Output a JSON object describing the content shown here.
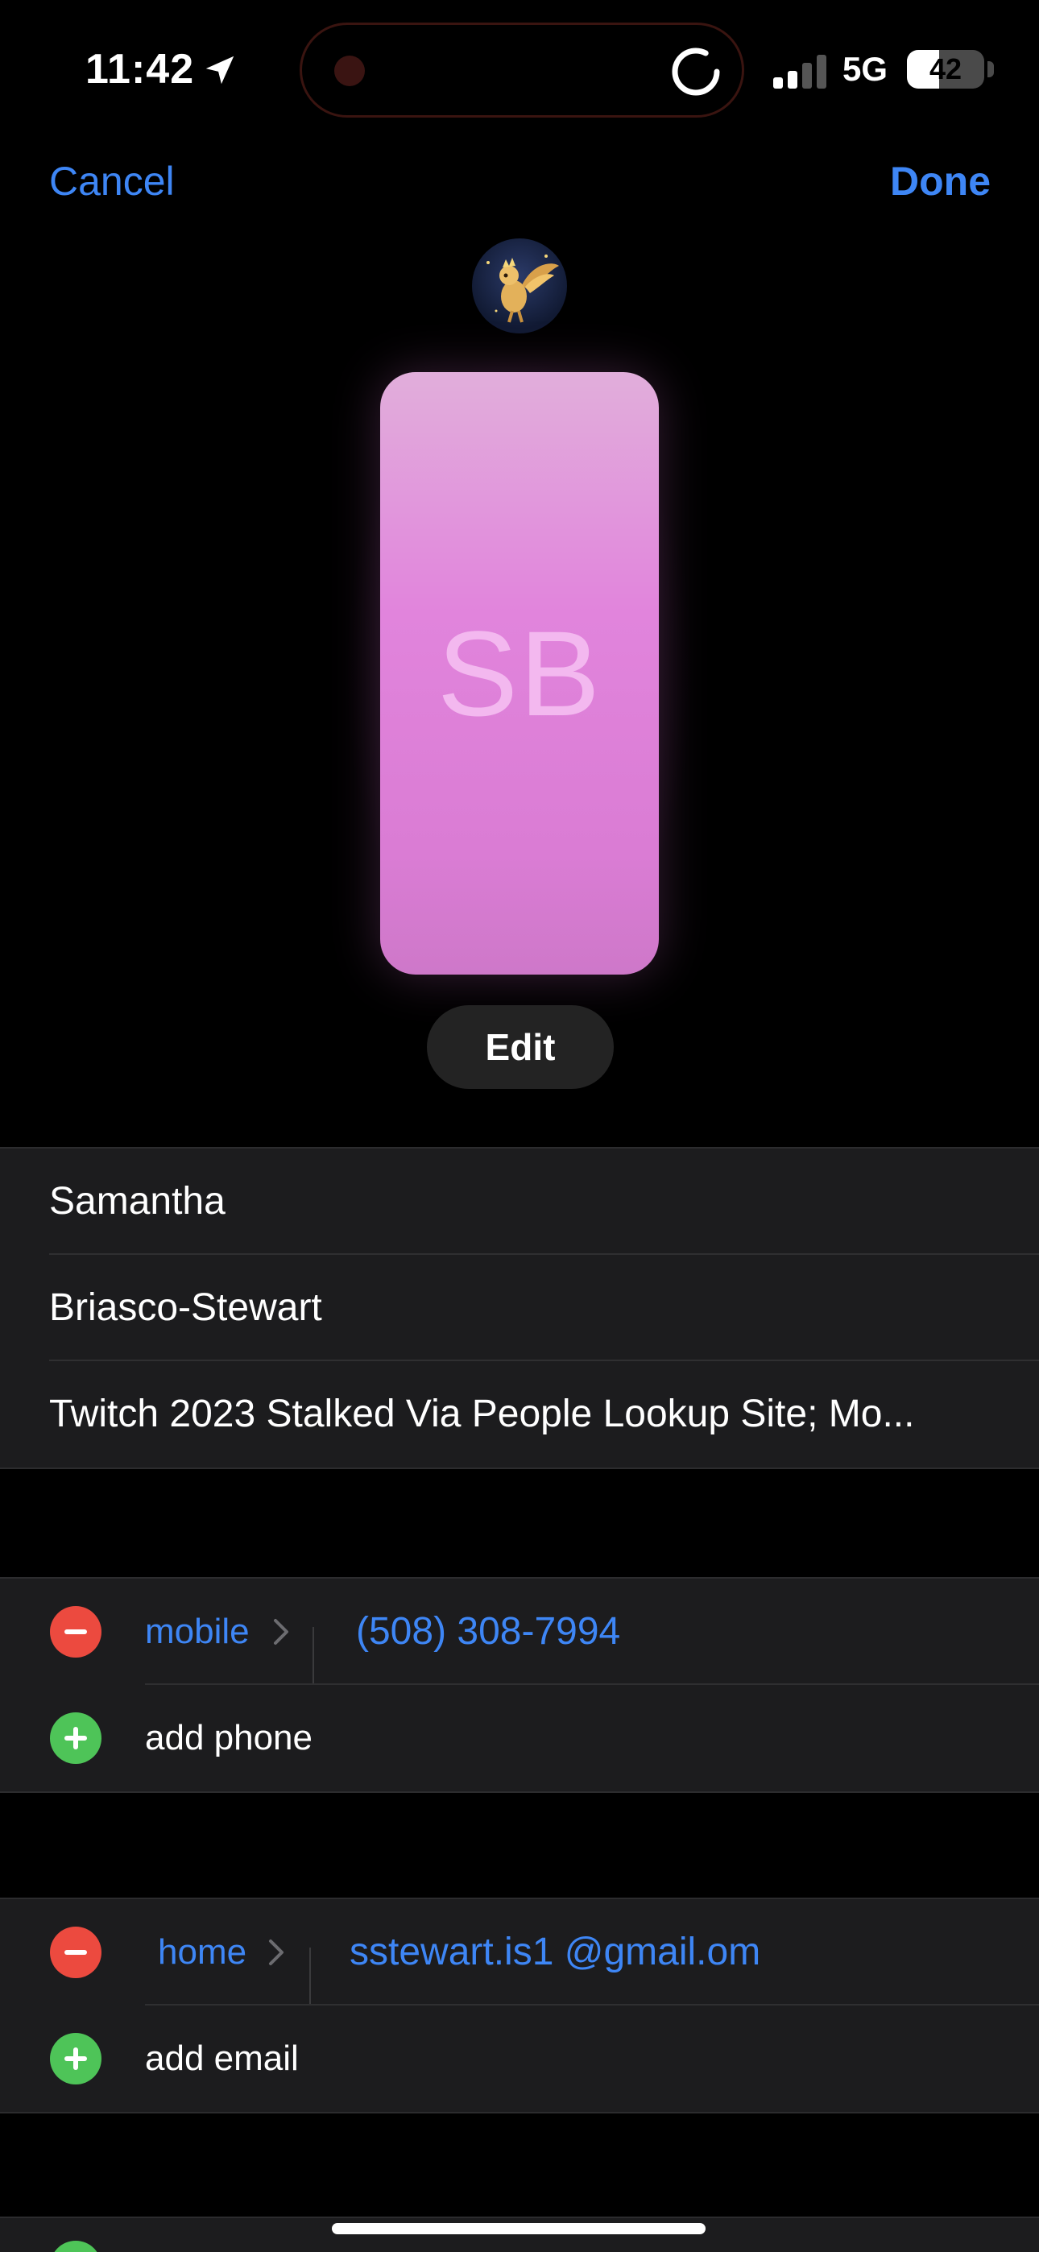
{
  "status_bar": {
    "time": "11:42",
    "network": "5G",
    "battery": "42",
    "battery_level": 0.42,
    "icons": [
      "location-arrow-icon",
      "loading-spinner-icon",
      "signal-bars-icon",
      "battery-icon"
    ]
  },
  "nav": {
    "cancel_label": "Cancel",
    "done_label": "Done"
  },
  "contact_poster": {
    "initials": "SB",
    "edit_label": "Edit",
    "colors": {
      "top": "#e1aedb",
      "bottom": "#ce78c9",
      "initials": "#f3b8ef"
    }
  },
  "name_fields": {
    "first_name": "Samantha",
    "last_name": "Briasco-Stewart",
    "company": "Twitch 2023 Stalked Via People Lookup Site; Mo..."
  },
  "phones": {
    "entries": [
      {
        "label": "mobile",
        "value": "(508) 308-7994"
      }
    ],
    "add_label": "add phone"
  },
  "emails": {
    "entries": [
      {
        "label": "home",
        "value": "sstewart.is1 @gmail.om"
      }
    ],
    "add_label": "add email"
  },
  "colors": {
    "accent": "#3e86f5",
    "delete": "#ec4a3f",
    "add": "#4ec458",
    "background": "#000000",
    "cell": "#1c1c1e"
  }
}
